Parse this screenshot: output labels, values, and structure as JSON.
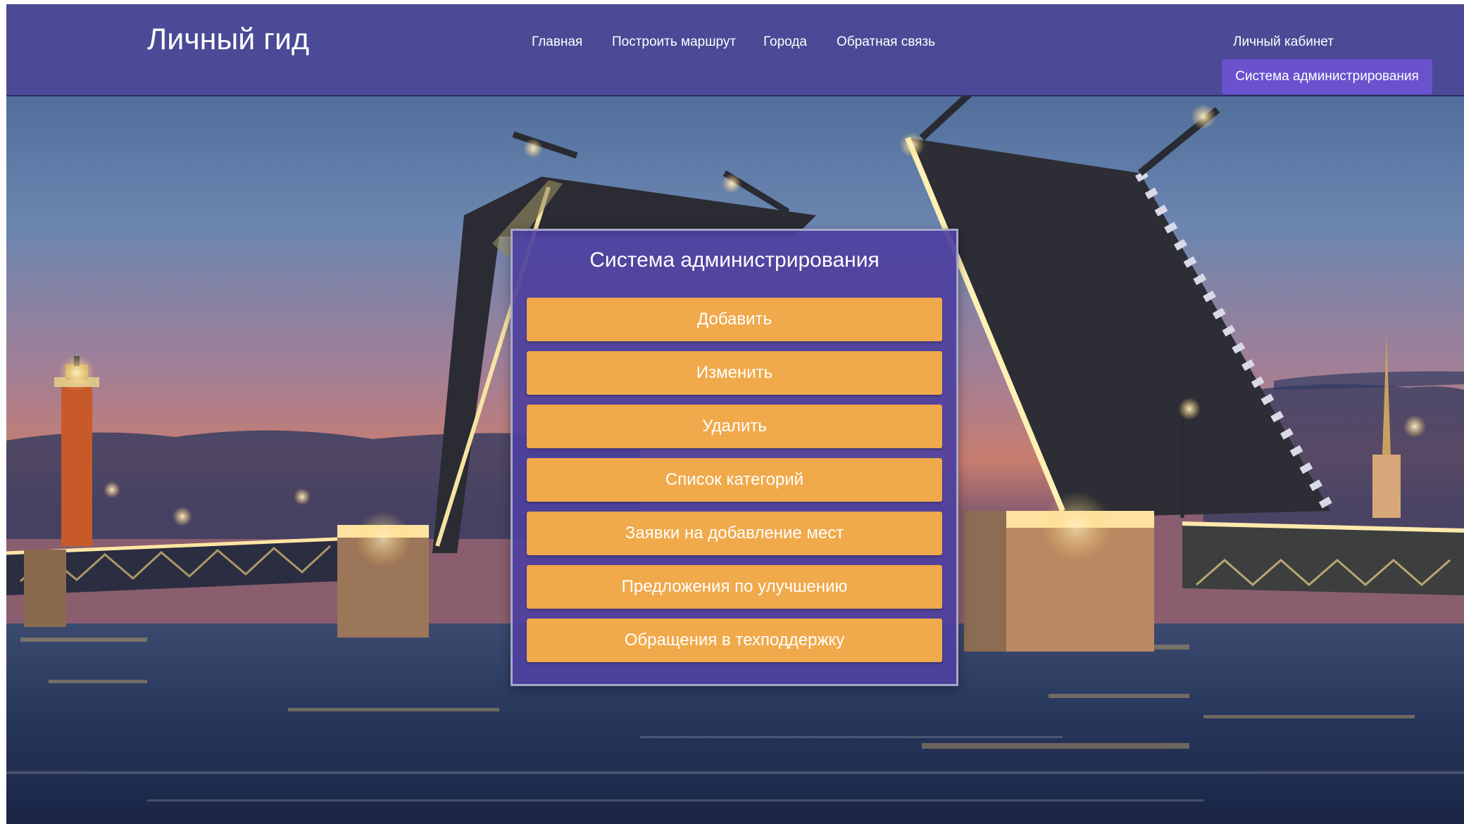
{
  "header": {
    "brand": "Личный гид",
    "nav": [
      "Главная",
      "Построить маршрут",
      "Города",
      "Обратная связь"
    ],
    "account_link": "Личный кабинет",
    "admin_button": "Система администрирования"
  },
  "panel": {
    "title": "Система администрирования",
    "buttons": [
      "Добавить",
      "Изменить",
      "Удалить",
      "Список категорий",
      "Заявки на добавление мест",
      "Предложения по улучшению",
      "Обращения в техподдержку"
    ]
  },
  "colors": {
    "navbar": "#4b4a96",
    "admin_button": "#6a52cf",
    "panel": "#4d409e",
    "action_button": "#f0a94b"
  }
}
